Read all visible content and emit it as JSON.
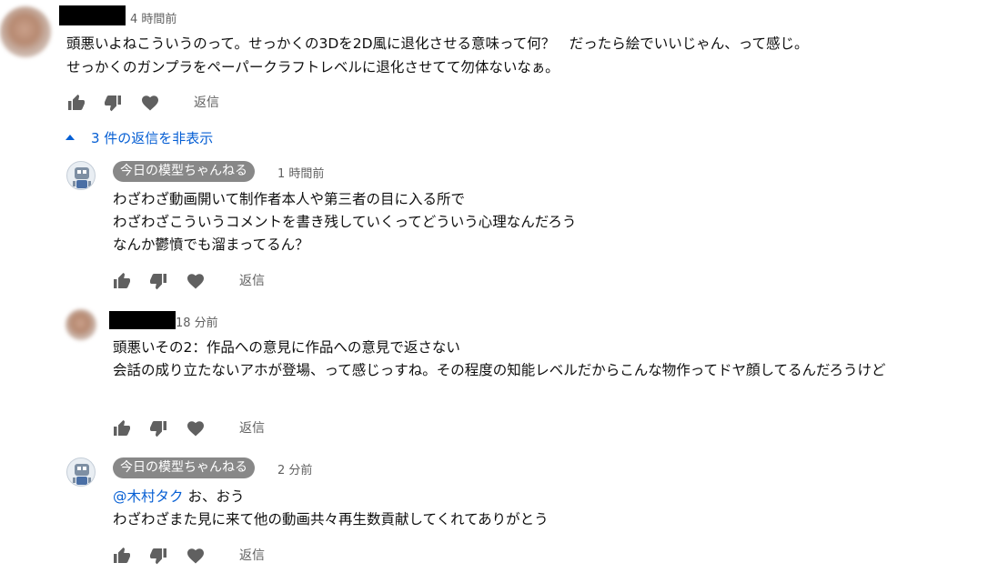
{
  "comments": [
    {
      "time": "4 時間前",
      "lines": [
        "頭悪いよねこういうのって。せっかくの3Dを2D風に退化させる意味って何？　だったら絵でいいじゃん、って感じ。",
        "せっかくのガンプラをペーパークラフトレベルに退化させてて勿体ないなぁ。"
      ],
      "reply_label": "返信"
    }
  ],
  "replies_toggle": {
    "label": "3 件の返信を非表示"
  },
  "replies": [
    {
      "author": "今日の模型ちゃんねる",
      "time": "1 時間前",
      "lines": [
        "わざわざ動画開いて制作者本人や第三者の目に入る所で",
        "わざわざこういうコメントを書き残していくってどういう心理なんだろう",
        "なんか鬱憤でも溜まってるん？"
      ],
      "reply_label": "返信"
    },
    {
      "time": "18 分前",
      "lines": [
        "頭悪いその2：作品への意見に作品への意見で返さない",
        "会話の成り立たないアホが登場、って感じっすね。その程度の知能レベルだからこんな物作ってドヤ顔してるんだろうけど"
      ],
      "reply_label": "返信"
    },
    {
      "author": "今日の模型ちゃんねる",
      "time": "2 分前",
      "mention": "@木村タク",
      "first_line_rest": " お、おう",
      "lines": [
        "わざわざまた見に来て他の動画共々再生数貢献してくれてありがとう"
      ],
      "reply_label": "返信"
    }
  ],
  "colors": {
    "link": "#065fd4",
    "chip": "#888888",
    "meta": "#606060",
    "icon": "#606060"
  }
}
